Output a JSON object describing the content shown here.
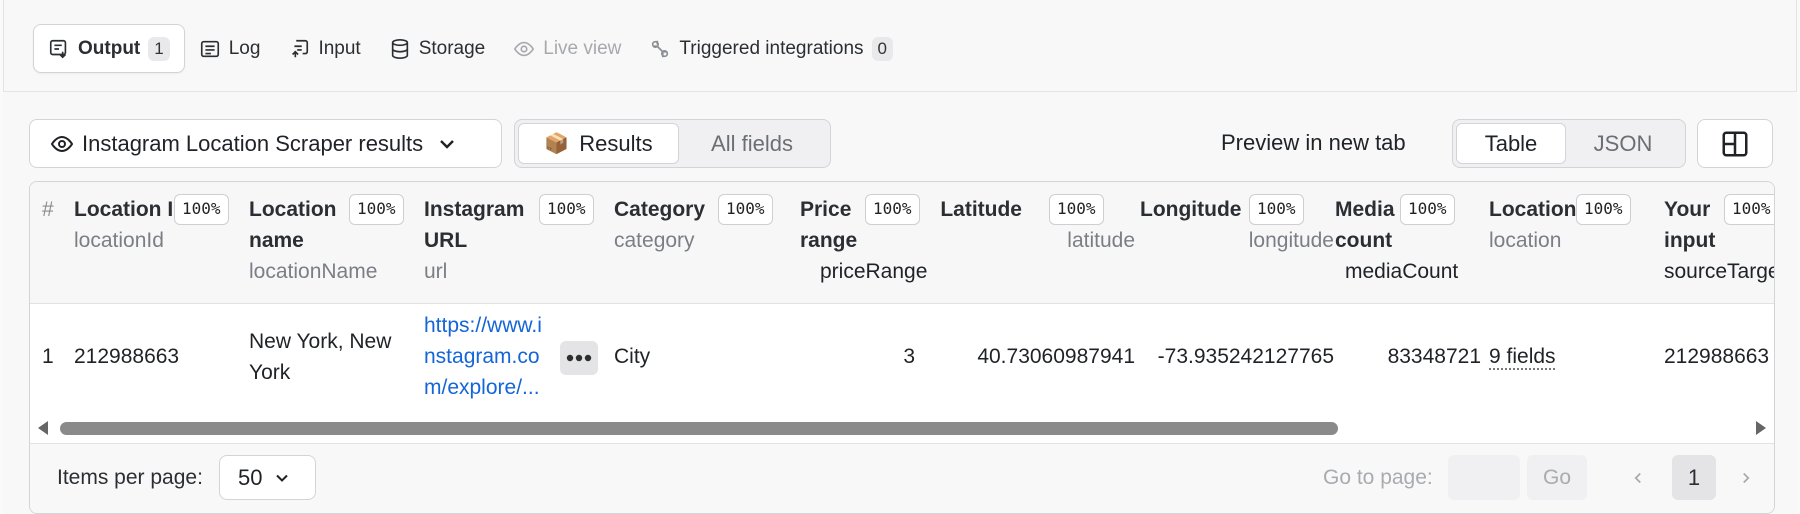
{
  "tabs": [
    {
      "label": "Output",
      "count": "1",
      "icon": "output-icon",
      "active": true
    },
    {
      "label": "Log",
      "icon": "log-icon"
    },
    {
      "label": "Input",
      "icon": "input-icon"
    },
    {
      "label": "Storage",
      "icon": "storage-icon"
    },
    {
      "label": "Live view",
      "icon": "live-view-icon",
      "disabled": true
    },
    {
      "label": "Triggered integrations",
      "count": "0",
      "icon": "integrations-icon"
    }
  ],
  "dataset_select": {
    "label": "Instagram Location Scraper results"
  },
  "view_toggle": {
    "results": "Results",
    "results_emoji": "📦",
    "all_fields": "All fields"
  },
  "preview_link": "Preview in new tab",
  "format_toggle": {
    "table": "Table",
    "json": "JSON"
  },
  "table": {
    "index_header": "#",
    "columns": [
      {
        "title": "Location ID",
        "key": "locationId",
        "pct": "100%"
      },
      {
        "title": "Location name",
        "key": "locationName",
        "pct": "100%"
      },
      {
        "title": "Instagram URL",
        "key": "url",
        "pct": "100%"
      },
      {
        "title": "Category",
        "key": "category",
        "pct": "100%"
      },
      {
        "title": "Price range",
        "key": "priceRange",
        "pct": "100%"
      },
      {
        "title": "Latitude",
        "key": "latitude",
        "pct": "100%"
      },
      {
        "title": "Longitude",
        "key": "longitude",
        "pct": "100%"
      },
      {
        "title": "Media count",
        "key": "mediaCount",
        "pct": "100%"
      },
      {
        "title": "Location",
        "key": "location",
        "pct": "100%"
      },
      {
        "title": "Your input",
        "key": "sourceTarget",
        "pct": "100%"
      }
    ],
    "rows": [
      {
        "index": "1",
        "locationId": "212988663",
        "locationName": "New York, New York",
        "url": "https://www.instagram.com/explore/...",
        "category": "City",
        "priceRange": "3",
        "latitude": "40.73060987941",
        "longitude": "-73.935242127765",
        "mediaCount": "83348721",
        "location": "9 fields",
        "sourceTarget": "212988663"
      }
    ]
  },
  "footer": {
    "items_per_page_label": "Items per page:",
    "items_per_page_value": "50",
    "go_to_page_label": "Go to page:",
    "go_button": "Go",
    "current_page": "1"
  },
  "colors": {
    "link": "#1565d8",
    "border": "#d4d4d8",
    "background": "#f8f8f8"
  }
}
